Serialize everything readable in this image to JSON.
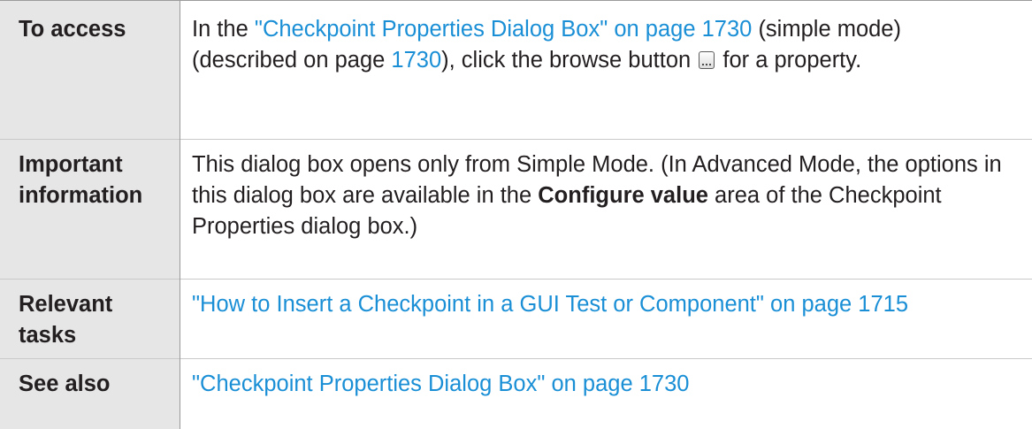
{
  "rows": [
    {
      "label": "To access",
      "desc": {
        "t1": "In the ",
        "link1": "\"Checkpoint Properties Dialog Box\" on page 1730",
        "t2": " (simple mode) (described on page ",
        "link2": "1730",
        "t3": "), click the browse button ",
        "icon": "browse-button-icon",
        "t4": " for a property."
      }
    },
    {
      "label_line1": "Important",
      "label_line2": "information",
      "desc": {
        "t1": "This dialog box opens only from Simple Mode. (In Advanced Mode, the options in this dialog box are available in the ",
        "bold1": "Configure value",
        "t2": " area of the Checkpoint Properties dialog box.)"
      }
    },
    {
      "label_line1": "Relevant",
      "label_line2": "tasks",
      "desc": {
        "link1": "\"How to Insert a Checkpoint in a GUI Test or Component\" on page 1715"
      }
    },
    {
      "label": "See also",
      "desc": {
        "link1": "\"Checkpoint Properties Dialog Box\" on page 1730"
      }
    }
  ],
  "colors": {
    "link": "#1a8fd6",
    "label_background": "#e6e6e6",
    "text": "#231f20"
  }
}
